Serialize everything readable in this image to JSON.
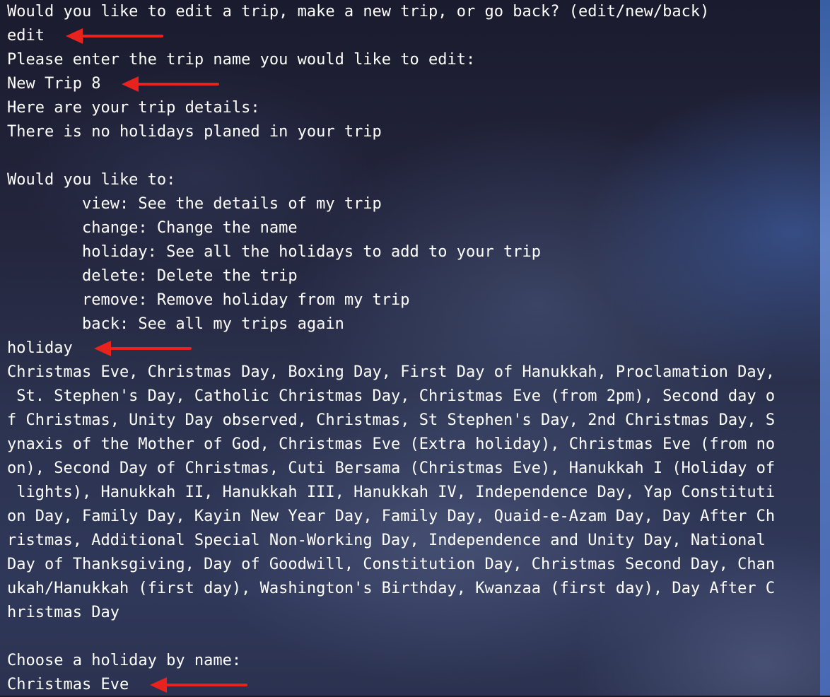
{
  "lines": [
    {
      "text": "Would you like to edit a trip, make a new trip, or go back? (edit/new/back)"
    },
    {
      "text": "edit",
      "arrow": true
    },
    {
      "text": "Please enter the trip name you would like to edit:"
    },
    {
      "text": "New Trip 8",
      "arrow": true
    },
    {
      "text": "Here are your trip details:"
    },
    {
      "text": "There is no holidays planed in your trip"
    },
    {
      "text": ""
    },
    {
      "text": "Would you like to:"
    },
    {
      "text": "        view: See the details of my trip"
    },
    {
      "text": "        change: Change the name"
    },
    {
      "text": "        holiday: See all the holidays to add to your trip"
    },
    {
      "text": "        delete: Delete the trip"
    },
    {
      "text": "        remove: Remove holiday from my trip"
    },
    {
      "text": "        back: See all my trips again"
    },
    {
      "text": "holiday",
      "arrow": true
    },
    {
      "text": "Christmas Eve, Christmas Day, Boxing Day, First Day of Hanukkah, Proclamation Day,"
    },
    {
      "text": " St. Stephen's Day, Catholic Christmas Day, Christmas Eve (from 2pm), Second day o"
    },
    {
      "text": "f Christmas, Unity Day observed, Christmas, St Stephen's Day, 2nd Christmas Day, S"
    },
    {
      "text": "ynaxis of the Mother of God, Christmas Eve (Extra holiday), Christmas Eve (from no"
    },
    {
      "text": "on), Second Day of Christmas, Cuti Bersama (Christmas Eve), Hanukkah I (Holiday of"
    },
    {
      "text": " lights), Hanukkah II, Hanukkah III, Hanukkah IV, Independence Day, Yap Constituti"
    },
    {
      "text": "on Day, Family Day, Kayin New Year Day, Family Day, Quaid-e-Azam Day, Day After Ch"
    },
    {
      "text": "ristmas, Additional Special Non-Working Day, Independence and Unity Day, National "
    },
    {
      "text": "Day of Thanksgiving, Day of Goodwill, Constitution Day, Christmas Second Day, Chan"
    },
    {
      "text": "ukah/Hanukkah (first day), Washington's Birthday, Kwanzaa (first day), Day After C"
    },
    {
      "text": "hristmas Day"
    },
    {
      "text": ""
    },
    {
      "text": "Choose a holiday by name:"
    },
    {
      "text": "Christmas Eve",
      "arrow": true
    }
  ],
  "arrow_color": "#e8231d"
}
